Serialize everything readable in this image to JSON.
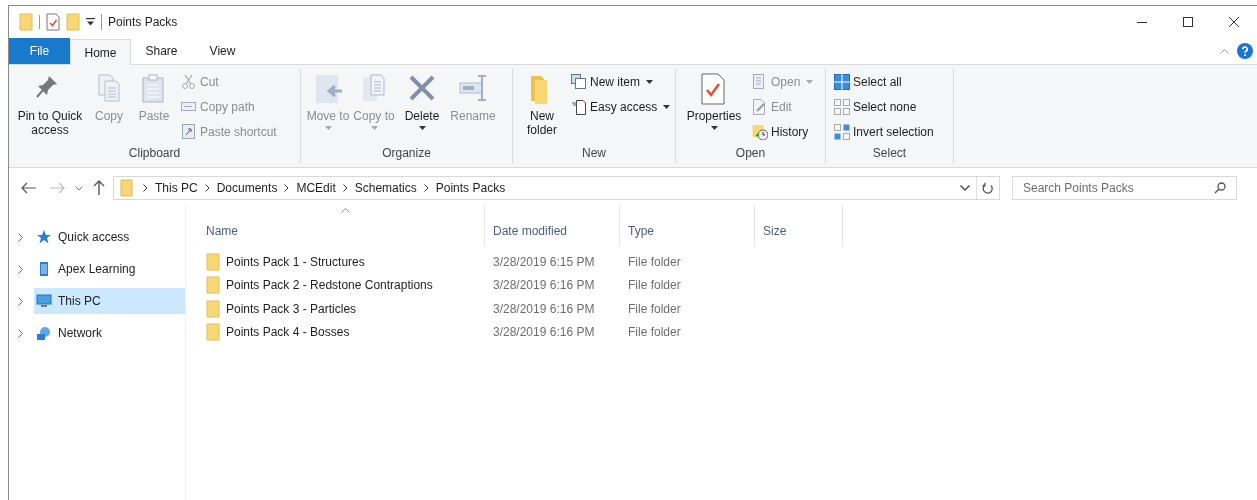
{
  "window": {
    "title": "Points Packs"
  },
  "tabs": [
    {
      "label": "File",
      "kind": "file",
      "selected": false
    },
    {
      "label": "Home",
      "kind": "normal",
      "selected": true
    },
    {
      "label": "Share",
      "kind": "normal",
      "selected": false
    },
    {
      "label": "View",
      "kind": "normal",
      "selected": false
    }
  ],
  "ribbon": {
    "groups": [
      {
        "label": "Clipboard",
        "commands": [
          {
            "label": "Pin to Quick access",
            "kind": "large",
            "disabled": false,
            "dropdown": false
          },
          {
            "label": "Copy",
            "kind": "large",
            "disabled": true,
            "dropdown": false
          },
          {
            "label": "Paste",
            "kind": "large",
            "disabled": true,
            "dropdown": false
          },
          {
            "label": "Cut",
            "kind": "small",
            "disabled": true,
            "dropdown": false
          },
          {
            "label": "Copy path",
            "kind": "small",
            "disabled": true,
            "dropdown": false
          },
          {
            "label": "Paste shortcut",
            "kind": "small",
            "disabled": true,
            "dropdown": false
          }
        ]
      },
      {
        "label": "Organize",
        "commands": [
          {
            "label": "Move to",
            "kind": "large",
            "disabled": true,
            "dropdown": true
          },
          {
            "label": "Copy to",
            "kind": "large",
            "disabled": true,
            "dropdown": true
          },
          {
            "label": "Delete",
            "kind": "large",
            "disabled": false,
            "dropdown": true
          },
          {
            "label": "Rename",
            "kind": "large",
            "disabled": true,
            "dropdown": false
          }
        ]
      },
      {
        "label": "New",
        "commands": [
          {
            "label": "New folder",
            "kind": "large",
            "disabled": false,
            "dropdown": false
          },
          {
            "label": "New item",
            "kind": "small",
            "disabled": false,
            "dropdown": true
          },
          {
            "label": "Easy access",
            "kind": "small",
            "disabled": false,
            "dropdown": true
          }
        ]
      },
      {
        "label": "Open",
        "commands": [
          {
            "label": "Properties",
            "kind": "large",
            "disabled": false,
            "dropdown": true
          },
          {
            "label": "Open",
            "kind": "small",
            "disabled": true,
            "dropdown": true
          },
          {
            "label": "Edit",
            "kind": "small",
            "disabled": true,
            "dropdown": false
          },
          {
            "label": "History",
            "kind": "small",
            "disabled": false,
            "dropdown": false
          }
        ]
      },
      {
        "label": "Select",
        "commands": [
          {
            "label": "Select all",
            "kind": "small",
            "disabled": false,
            "dropdown": false
          },
          {
            "label": "Select none",
            "kind": "small",
            "disabled": false,
            "dropdown": false
          },
          {
            "label": "Invert selection",
            "kind": "small",
            "disabled": false,
            "dropdown": false
          }
        ]
      }
    ]
  },
  "address_bar": {
    "path": [
      "This PC",
      "Documents",
      "MCEdit",
      "Schematics",
      "Points Packs"
    ]
  },
  "search": {
    "placeholder": "Search Points Packs"
  },
  "sidebar": {
    "items": [
      {
        "label": "Quick access",
        "selected": false
      },
      {
        "label": "Apex Learning",
        "selected": false
      },
      {
        "label": "This PC",
        "selected": true
      },
      {
        "label": "Network",
        "selected": false
      }
    ]
  },
  "table": {
    "columns": [
      {
        "label": "Name",
        "sorted": true
      },
      {
        "label": "Date modified",
        "sorted": false
      },
      {
        "label": "Type",
        "sorted": false
      },
      {
        "label": "Size",
        "sorted": false
      }
    ],
    "rows": [
      {
        "name": "Points Pack 1 - Structures",
        "date_modified": "3/28/2019 6:15 PM",
        "type": "File folder"
      },
      {
        "name": "Points Pack 2 - Redstone Contraptions",
        "date_modified": "3/28/2019 6:16 PM",
        "type": "File folder"
      },
      {
        "name": "Points Pack 3 - Particles",
        "date_modified": "3/28/2019 6:16 PM",
        "type": "File folder"
      },
      {
        "name": "Points Pack 4 - Bosses",
        "date_modified": "3/28/2019 6:16 PM",
        "type": "File folder"
      }
    ]
  }
}
